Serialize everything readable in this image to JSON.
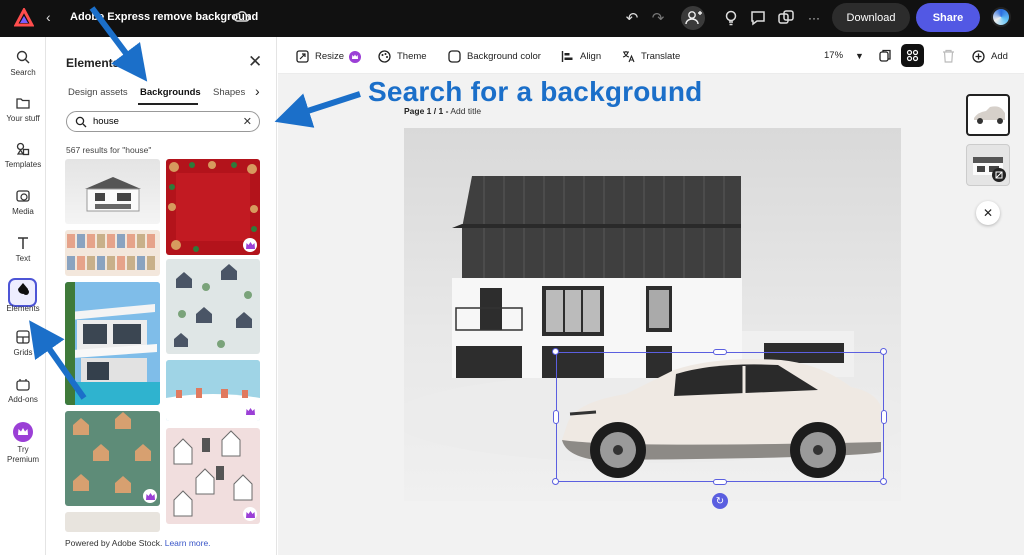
{
  "header": {
    "doc_title": "Adobe Express remove background",
    "download_label": "Download",
    "share_label": "Share",
    "more_label": "···"
  },
  "rail": {
    "items": [
      {
        "label": "Search",
        "icon": "search-icon"
      },
      {
        "label": "Your stuff",
        "icon": "folder-icon"
      },
      {
        "label": "Templates",
        "icon": "templates-icon"
      },
      {
        "label": "Media",
        "icon": "media-icon"
      },
      {
        "label": "Text",
        "icon": "text-icon"
      },
      {
        "label": "Elements",
        "icon": "elements-icon"
      },
      {
        "label": "Grids",
        "icon": "grids-icon"
      },
      {
        "label": "Add-ons",
        "icon": "addons-icon"
      },
      {
        "label": "Try Premium",
        "icon": "crown-icon"
      }
    ]
  },
  "panel": {
    "title": "Elements",
    "tabs": [
      "Design assets",
      "Backgrounds",
      "Shapes"
    ],
    "active_tab": "Backgrounds",
    "search_value": "house",
    "results_text": "567 results for \"house\"",
    "footer_text": "Powered by Adobe Stock.",
    "footer_link": "Learn more."
  },
  "toolbar": {
    "resize": "Resize",
    "theme": "Theme",
    "background_color": "Background color",
    "align": "Align",
    "translate": "Translate",
    "zoom": "17%",
    "add": "Add"
  },
  "canvas": {
    "annotation_heading": "Search for a background",
    "page_label": "Page 1 / 1 -",
    "add_title": "Add title"
  },
  "colors": {
    "accent": "#5258e4",
    "annotation_blue": "#1b6fc9",
    "topbar": "#111111"
  }
}
